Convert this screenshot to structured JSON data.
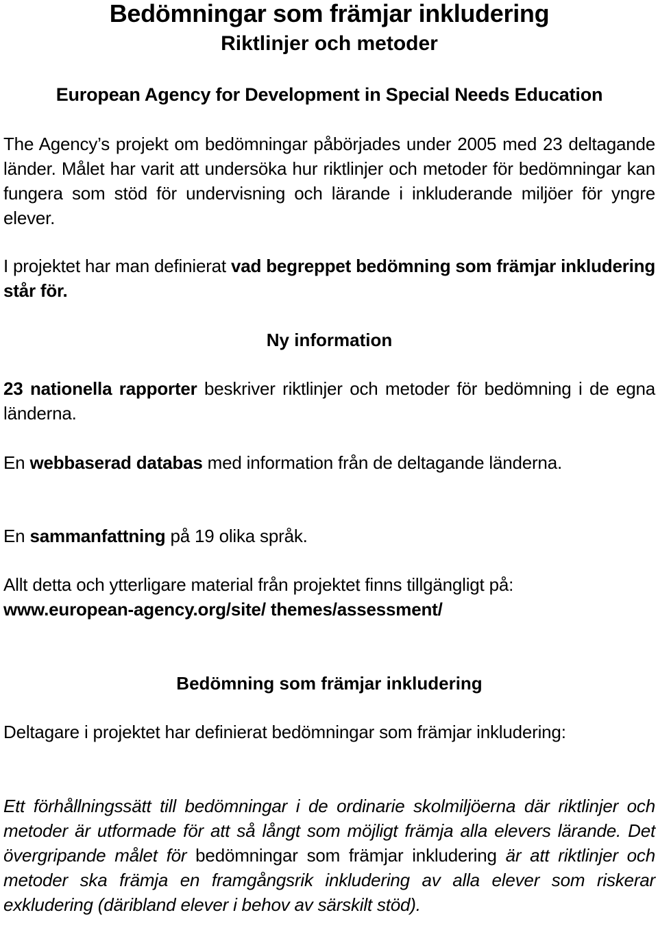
{
  "document": {
    "title": "Bedömningar som främjar inkludering",
    "subtitle": "Riktlinjer och metoder",
    "organization": "European Agency for Development in Special Needs Education",
    "intro": {
      "text": "The Agency’s projekt om bedömningar påbörjades under 2005 med 23 deltagande länder. Målet har varit att undersöka hur riktlinjer och metoder för bedömningar kan fungera som stöd för undervisning och lärande i inkluderande miljöer för yngre elever."
    },
    "definition_para": {
      "plain": "I projektet har man definierat ",
      "bold": "vad begreppet bedömning som främjar inkludering står för."
    },
    "new_info_heading": "Ny information",
    "reports_para": {
      "bold": "23 nationella rapporter",
      "plain": " beskriver riktlinjer och metoder för bedömning i de egna länderna."
    },
    "database_para": {
      "plain_before": "En ",
      "bold": "webbaserad databas",
      "plain_after": " med information från de deltagande länderna."
    },
    "summary_para": {
      "plain_before": "En ",
      "bold": "sammanfattning",
      "plain_after": " på 19 olika språk."
    },
    "availability_para": {
      "text": "Allt detta och ytterligare material från projektet finns tillgängligt på:",
      "url": "www.european-agency.org/site/ themes/assessment/"
    },
    "section_heading": "Bedömning som främjar inkludering",
    "participants_para": "Deltagare i projektet har definierat bedömningar som främjar inkludering:",
    "definition_quote": {
      "italic_1": "Ett förhållningssätt till bedömningar i de ordinarie skolmiljöerna där riktlinjer och metoder är utformade för att så långt som möjligt främja alla elevers lärande. Det övergripande målet för ",
      "upright": "bedömningar som främjar inkludering",
      "italic_2": " är att riktlinjer och metoder ska främja en framgångsrik inkludering av alla elever som riskerar exkludering (däribland elever i behov av särskilt stöd)."
    }
  }
}
